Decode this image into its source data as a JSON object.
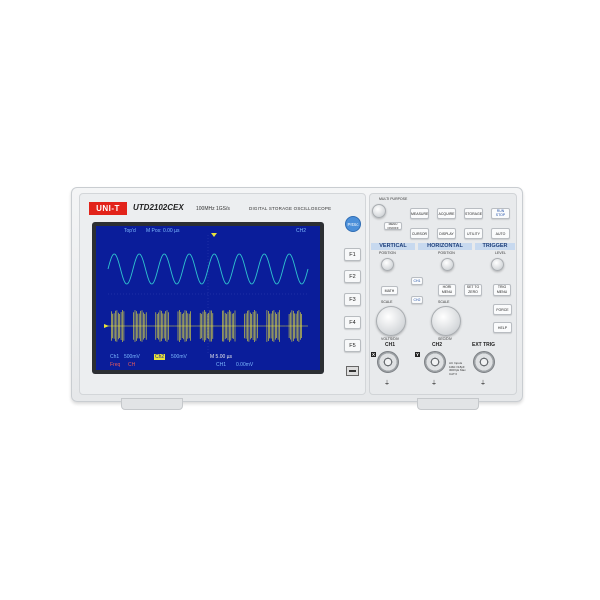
{
  "brand": {
    "logo": "UNI-T",
    "model": "UTD2102CEX",
    "spec": "100MHz  1GS/s",
    "description": "DIGITAL STORAGE OSCILLOSCOPE"
  },
  "screen": {
    "top_left": "Top'd",
    "top_mid": "M Pos: 0.00 µs",
    "top_right": "CH2",
    "bottom_row1": [
      "Ch1",
      "500mV",
      "Ch2",
      "500mV",
      "M 5.00 µs"
    ],
    "bottom_row2": [
      "Freq",
      "CH",
      "CH1",
      "0.00mV"
    ],
    "colors": {
      "background": "#0a1d9a",
      "ch1": "#2fc4cf",
      "ch2": "#e8e23a",
      "text": "#7db9ff"
    }
  },
  "side_keys": [
    "PrtSc",
    "F1",
    "F2",
    "F3",
    "F4",
    "F5"
  ],
  "panel": {
    "multipurpose": "MULTI PURPOSE",
    "menu_on_off": "MENU ON/OFF",
    "buttons_row1": [
      "MEASURE",
      "ACQUIRE",
      "STORAGE",
      "RUN STOP"
    ],
    "buttons_row2": [
      "CURSOR",
      "DISPLAY",
      "UTILITY",
      "AUTO"
    ],
    "sections": [
      "VERTICAL",
      "HORIZONTAL",
      "TRIGGER"
    ],
    "position": "POSITION",
    "level": "LEVEL",
    "scale": "SCALE",
    "ch1_btn": "CH1",
    "ch2_btn": "CH2",
    "math_btn": "MATH",
    "hori_menu": "HORI MENU",
    "set_to_zero": "SET TO ZERO",
    "trig_menu": "TRIG MENU",
    "force": "FORCE",
    "help": "HELP",
    "volts_div": "VOLTS/DIV",
    "sec_div": "SEC/DIV",
    "connectors": [
      "CH1",
      "CH2",
      "EXT TRIG"
    ],
    "x_label": "X",
    "y_label": "Y",
    "input_note": "AC Inputs 1MΩ //18pF 300Vpk Max CAT II"
  }
}
